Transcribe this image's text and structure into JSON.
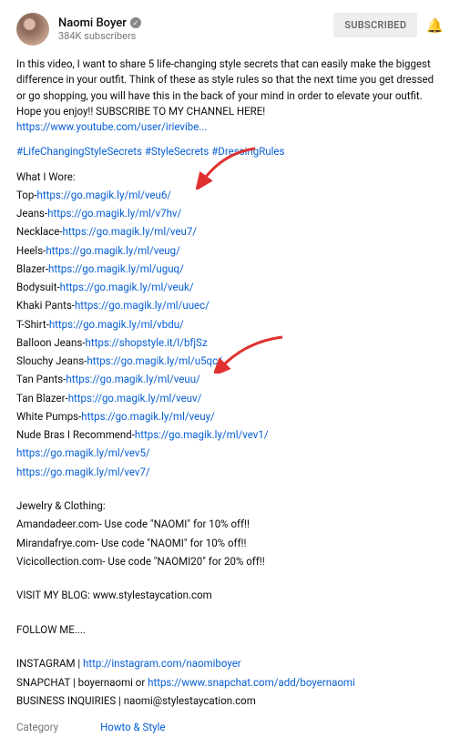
{
  "channel": {
    "name": "Naomi Boyer",
    "subs": "384K subscribers"
  },
  "subscribe_btn": "SUBSCRIBED",
  "intro": "In this video, I want to share 5 life-changing style secrets that can easily make the biggest difference in your outfit.  Think of these as style rules so that the next time you get dressed or go shopping, you will have this in the back of your mind in order to elevate your outfit.  Hope you enjoy!! SUBSCRIBE TO MY CHANNEL HERE! ",
  "intro_link": "https://www.youtube.com/user/irievibe...",
  "hashtags": "#LifeChangingStyleSecrets #StyleSecrets #DressingRules",
  "wore_title": "What I Wore:",
  "wore": [
    {
      "label": "Top-",
      "url": "https://go.magik.ly/ml/veu6/"
    },
    {
      "label": "Jeans-",
      "url": "https://go.magik.ly/ml/v7hv/"
    },
    {
      "label": "Necklace-",
      "url": "https://go.magik.ly/ml/veu7/"
    },
    {
      "label": "Heels-",
      "url": "https://go.magik.ly/ml/veug/"
    },
    {
      "label": "Blazer-",
      "url": "https://go.magik.ly/ml/uguq/"
    },
    {
      "label": "Bodysuit-",
      "url": "https://go.magik.ly/ml/veuk/"
    },
    {
      "label": "Khaki Pants-",
      "url": "https://go.magik.ly/ml/uuec/"
    },
    {
      "label": "T-Shirt-",
      "url": "https://go.magik.ly/ml/vbdu/"
    },
    {
      "label": "Balloon Jeans-",
      "url": "https://shopstyle.it/l/bfjSz"
    },
    {
      "label": "Slouchy Jeans-",
      "url": "https://go.magik.ly/ml/u5qc/"
    },
    {
      "label": "Tan Pants-",
      "url": "https://go.magik.ly/ml/veuu/"
    },
    {
      "label": "Tan Blazer-",
      "url": "https://go.magik.ly/ml/veuv/"
    },
    {
      "label": "White Pumps-",
      "url": "https://go.magik.ly/ml/veuy/"
    },
    {
      "label": "Nude Bras I Recommend-",
      "url": "https://go.magik.ly/ml/vev1/"
    },
    {
      "label": "",
      "url": "https://go.magik.ly/ml/vev5/"
    },
    {
      "label": "",
      "url": "https://go.magik.ly/ml/vev7/"
    }
  ],
  "jewel_title": "Jewelry & Clothing:",
  "jewel": [
    "Amandadeer.com- Use code \"NAOMI\" for 10% off!!",
    "Mirandafrye.com- Use code \"NAOMI\" for 10% off!!",
    "Vicicollection.com- Use code \"NAOMI20\" for 20% off!!"
  ],
  "blog": "VISIT MY BLOG: www.stylestaycation.com",
  "follow": "FOLLOW ME....",
  "insta_lab": "INSTAGRAM | ",
  "insta_url": "http://instagram.com/naomiboyer",
  "snap_lab": "SNAPCHAT | boyernaomi or ",
  "snap_url": "https://www.snapchat.com/add/boyernaomi",
  "biz": "BUSINESS INQUIRIES  |   naomi@stylestaycation.com",
  "cat_label": "Category",
  "cat_value": "Howto & Style"
}
